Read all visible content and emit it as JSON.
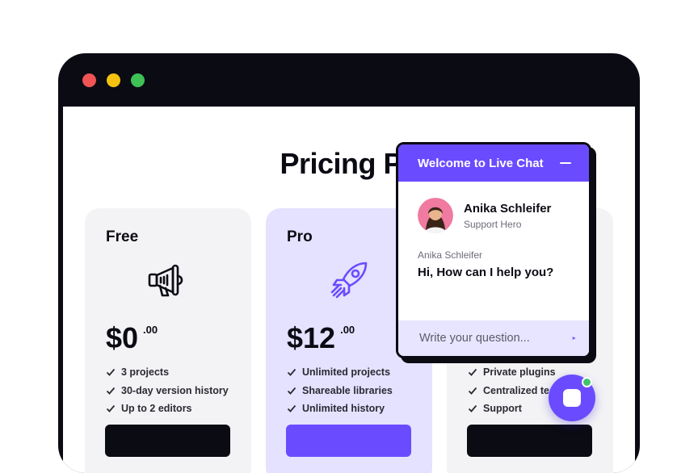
{
  "window": {
    "dots": [
      {
        "name": "close-dot",
        "color": "#f05454"
      },
      {
        "name": "minimize-dot",
        "color": "#f5c30f"
      },
      {
        "name": "maximize-dot",
        "color": "#3fc155"
      }
    ]
  },
  "page": {
    "title": "Pricing Pa"
  },
  "plans": [
    {
      "name": "Free",
      "icon": "megaphone-icon",
      "price": "$0",
      "cents": ".00",
      "features": [
        "3 projects",
        "30-day version history",
        "Up to 2 editors"
      ]
    },
    {
      "name": "Pro",
      "icon": "rocket-icon",
      "price": "$12",
      "cents": ".00",
      "features": [
        "Unlimited projects",
        "Shareable libraries",
        "Unlimited history"
      ]
    },
    {
      "name": "",
      "icon": "",
      "price": "",
      "cents": "",
      "features": [
        "Private plugins",
        "Centralized tea",
        "Support"
      ]
    }
  ],
  "chat": {
    "title": "Welcome to Live Chat",
    "agent_name": "Anika Schleifer",
    "agent_role": "Support Hero",
    "message_author": "Anika Schleifer",
    "message_text": "Hi, How can I help you?",
    "input_placeholder": "Write your question..."
  },
  "colors": {
    "accent": "#6b4bff",
    "dark": "#0b0b14",
    "online": "#3ec46d"
  }
}
